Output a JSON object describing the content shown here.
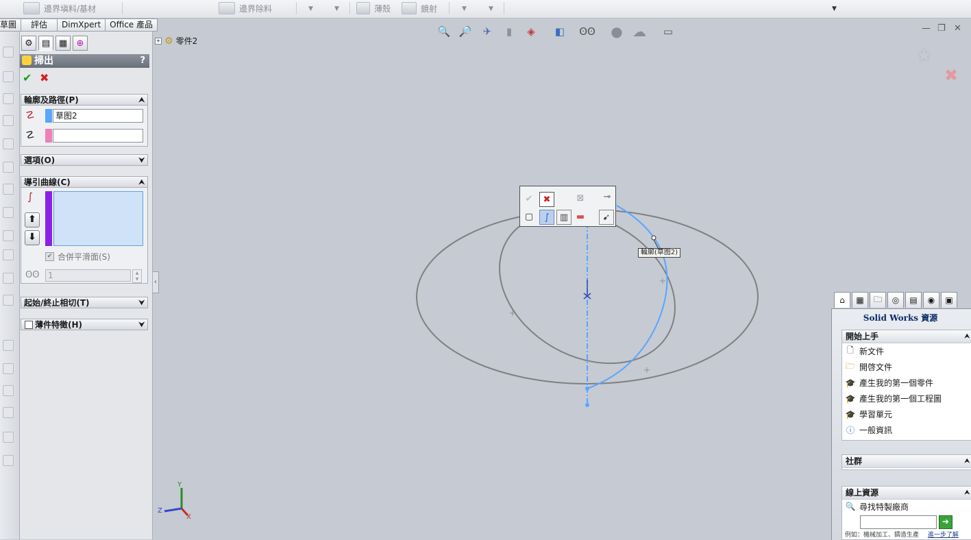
{
  "toolbar": {
    "boundary_boss": "邊界塡料/基材",
    "boundary_cut": "邊界除料",
    "shell": "薄殼",
    "mirror": "鏡射"
  },
  "tabs": [
    "草圖",
    "評估",
    "DimXpert",
    "Office 產品"
  ],
  "tree": {
    "part_name": "零件2"
  },
  "property_manager": {
    "title": "掃出",
    "help": "?",
    "profile_path": {
      "header": "輪廓及路徑(P)",
      "profile_value": "草图2",
      "path_value": ""
    },
    "options": {
      "header": "選項(O)"
    },
    "guide_curves": {
      "header": "導引曲線(C)",
      "merge_smooth_faces": "合併平滑面(S)",
      "count_value": "1"
    },
    "start_end_tangency": {
      "header": "起始/終止相切(T)"
    },
    "thin_feature": {
      "header": "薄件特徵(H)"
    }
  },
  "graphics": {
    "callout": "輪廓(草图2)",
    "triad": {
      "x": "X",
      "y": "Y",
      "z": "Z"
    }
  },
  "task_pane": {
    "title": "Solid Works 資源",
    "getting_started": {
      "header": "開始上手",
      "items": [
        "新文件",
        "開啓文件",
        "產生我的第一個零件",
        "產生我的第一個工程圖",
        "學習單元",
        "一般資訊"
      ]
    },
    "community": {
      "header": "社群"
    },
    "online": {
      "header": "線上資源",
      "find_vendor": "尋找特製廠商",
      "search_value": "",
      "hint": "例如：機械加工、鑄造生產",
      "more": "進一步了解"
    }
  },
  "colors": {
    "accent_blue": "#58a6ff",
    "swatch_pink": "#f080b8",
    "guide_purple": "#8a22e6",
    "sketch_gray": "#808080"
  }
}
